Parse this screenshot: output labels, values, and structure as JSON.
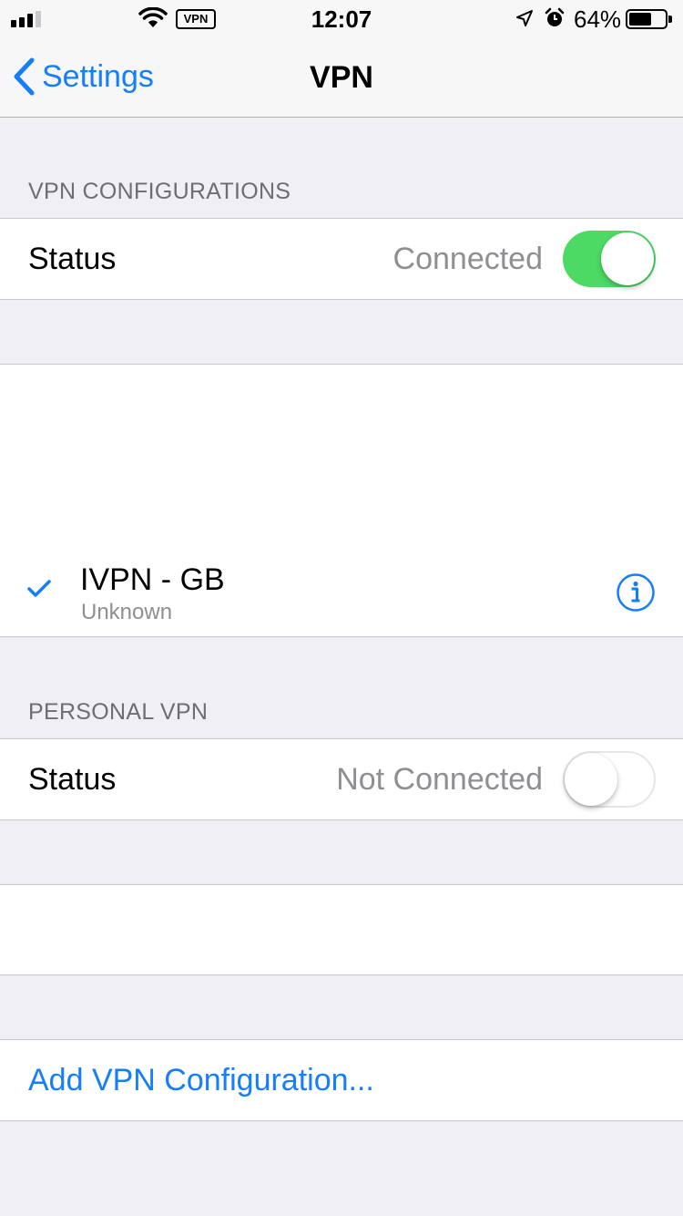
{
  "status_bar": {
    "time": "12:07",
    "vpn_badge": "VPN",
    "battery_percent": "64%",
    "battery_level": 0.64
  },
  "nav": {
    "back_label": "Settings",
    "title": "VPN"
  },
  "vpn_configurations": {
    "header": "VPN CONFIGURATIONS",
    "status_label": "Status",
    "status_value": "Connected",
    "toggle_on": true
  },
  "configuration_list": {
    "items": [
      {
        "name": "IVPN - GB",
        "subtitle": "Unknown",
        "selected": true
      }
    ]
  },
  "personal_vpn": {
    "header": "PERSONAL VPN",
    "status_label": "Status",
    "status_value": "Not Connected",
    "toggle_on": false
  },
  "actions": {
    "add_vpn_label": "Add VPN Configuration..."
  },
  "colors": {
    "accent": "#147efb",
    "toggle_on": "#4cd964",
    "background": "#efeff4",
    "secondary_text": "#8e8e93"
  }
}
